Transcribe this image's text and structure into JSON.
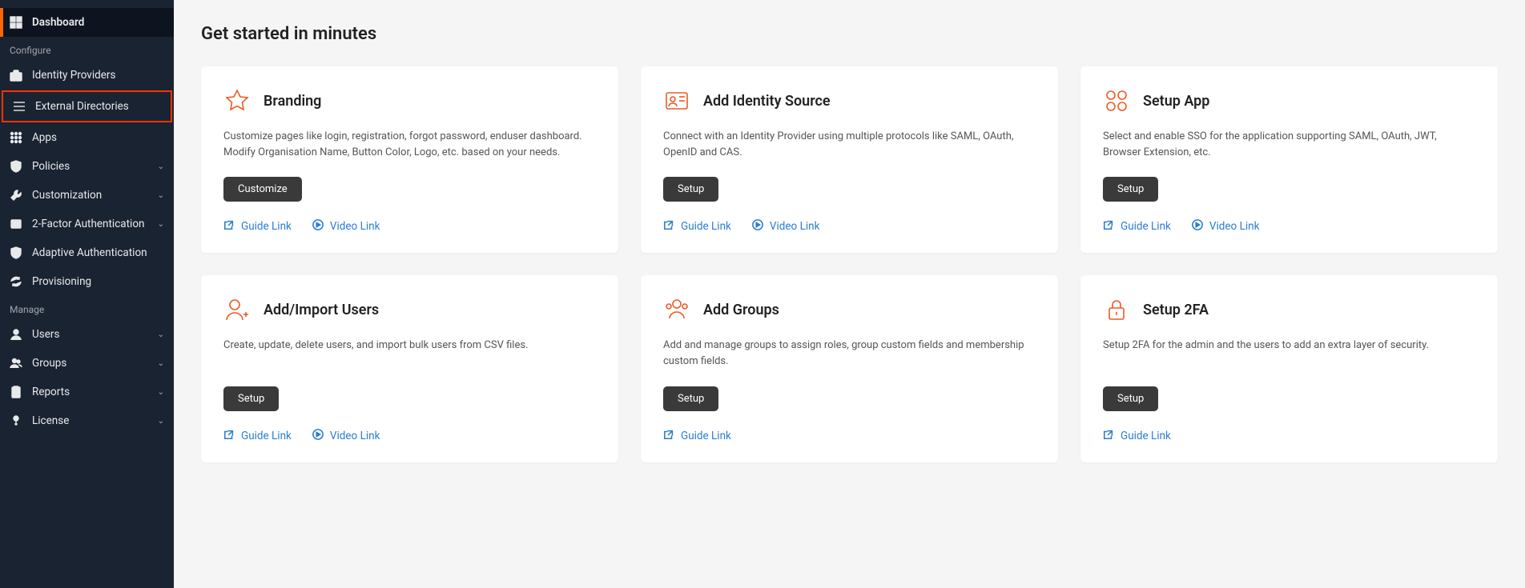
{
  "sidebar": {
    "items": [
      {
        "label": "Dashboard",
        "icon": "dashboard",
        "active": true
      },
      {
        "section": "Configure"
      },
      {
        "label": "Identity Providers",
        "icon": "briefcase"
      },
      {
        "label": "External Directories",
        "icon": "list",
        "highlight": true
      },
      {
        "label": "Apps",
        "icon": "grid"
      },
      {
        "label": "Policies",
        "icon": "shield-gear",
        "expandable": true
      },
      {
        "label": "Customization",
        "icon": "wrench",
        "expandable": true
      },
      {
        "label": "2-Factor Authentication",
        "icon": "badge",
        "expandable": true
      },
      {
        "label": "Adaptive Authentication",
        "icon": "shield"
      },
      {
        "label": "Provisioning",
        "icon": "sync"
      },
      {
        "section": "Manage"
      },
      {
        "label": "Users",
        "icon": "user",
        "expandable": true
      },
      {
        "label": "Groups",
        "icon": "users",
        "expandable": true
      },
      {
        "label": "Reports",
        "icon": "clipboard",
        "expandable": true
      },
      {
        "label": "License",
        "icon": "key",
        "expandable": true
      }
    ]
  },
  "page_title": "Get started in minutes",
  "guide_label": "Guide Link",
  "video_label": "Video Link",
  "cards": [
    {
      "title": "Branding",
      "icon": "star",
      "desc": "Customize pages like login, registration, forgot password, enduser dashboard. Modify Organisation Name, Button Color, Logo, etc. based on your needs.",
      "button": "Customize",
      "guide": true,
      "video": true
    },
    {
      "title": "Add Identity Source",
      "icon": "idcard",
      "desc": "Connect with an Identity Provider using multiple protocols like SAML, OAuth, OpenID and CAS.",
      "button": "Setup",
      "guide": true,
      "video": true
    },
    {
      "title": "Setup App",
      "icon": "apps",
      "desc": "Select and enable SSO for the application supporting SAML, OAuth, JWT, Browser Extension, etc.",
      "button": "Setup",
      "guide": true,
      "video": true
    },
    {
      "title": "Add/Import Users",
      "icon": "user-plus",
      "desc": "Create, update, delete users, and import bulk users from CSV files.",
      "button": "Setup",
      "guide": true,
      "video": true
    },
    {
      "title": "Add Groups",
      "icon": "group",
      "desc": "Add and manage groups to assign roles, group custom fields and membership custom fields.",
      "button": "Setup",
      "guide": true,
      "video": false
    },
    {
      "title": "Setup 2FA",
      "icon": "lock",
      "desc": "Setup 2FA for the admin and the users to add an extra layer of security.",
      "button": "Setup",
      "guide": true,
      "video": false
    }
  ]
}
